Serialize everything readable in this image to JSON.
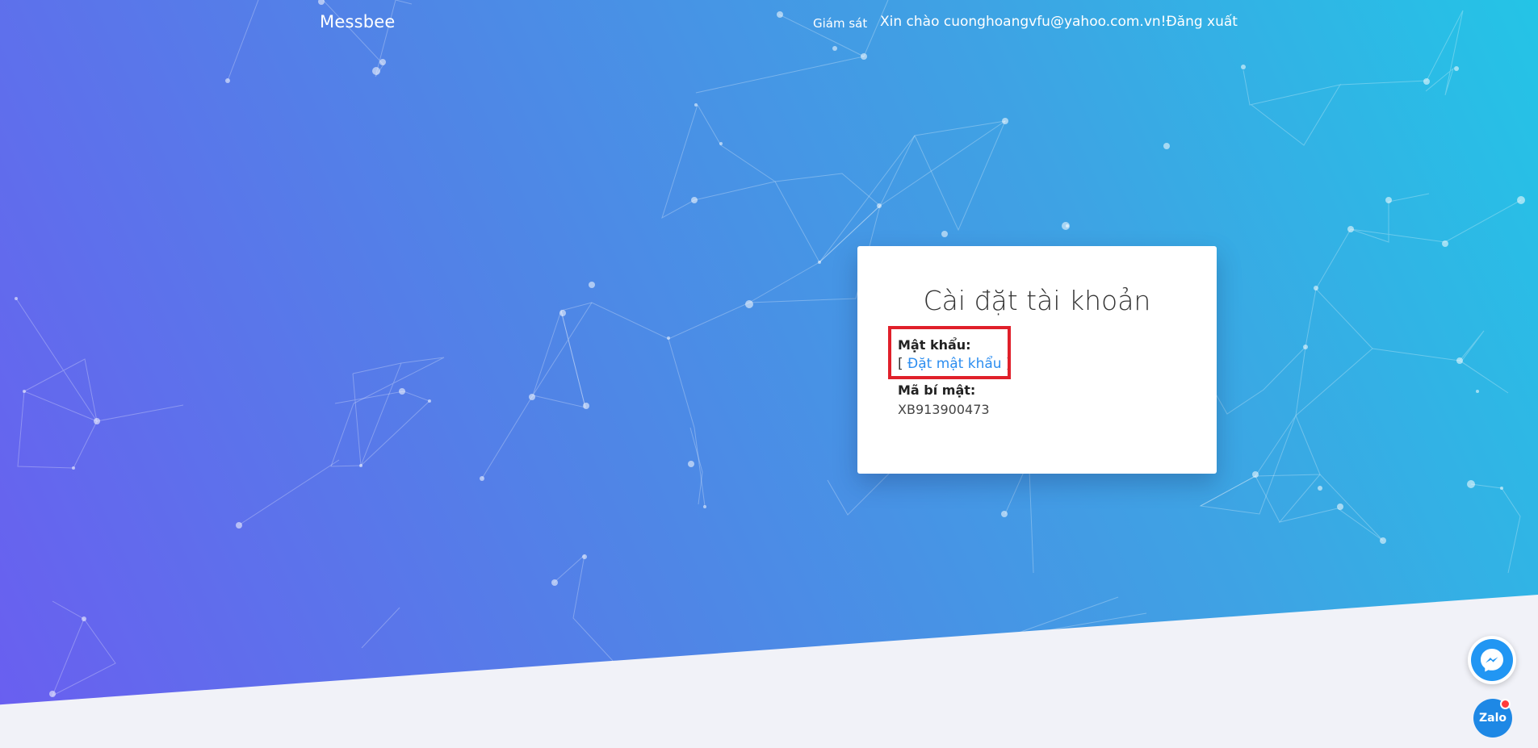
{
  "nav": {
    "brand": "Messbee",
    "monitor": "Giám sát",
    "greeting": "Xin chào cuonghoangvfu@yahoo.com.vn!",
    "logout": "Đăng xuất"
  },
  "card": {
    "title": "Cài đặt tài khoản",
    "password_label": "Mật khẩu:",
    "password_open": "[ ",
    "password_link": "Đặt mật khẩu",
    "password_close": " ]",
    "secret_label": "Mã bí mật:",
    "secret_value": "XB913900473"
  },
  "chat": {
    "zalo_label": "Zalo"
  },
  "colors": {
    "accent": "#2d8ef0",
    "highlight": "#e0202a",
    "messenger": "#2196f3",
    "zalo": "#1e88e5"
  },
  "icons": [
    "messenger-icon",
    "zalo-icon"
  ]
}
